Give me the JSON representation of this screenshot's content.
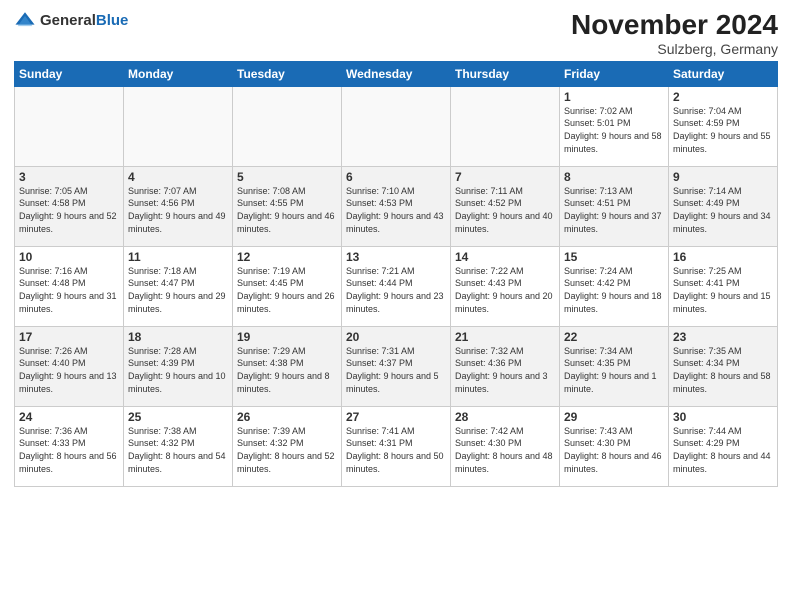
{
  "header": {
    "logo_general": "General",
    "logo_blue": "Blue",
    "month_title": "November 2024",
    "location": "Sulzberg, Germany"
  },
  "weekdays": [
    "Sunday",
    "Monday",
    "Tuesday",
    "Wednesday",
    "Thursday",
    "Friday",
    "Saturday"
  ],
  "weeks": [
    [
      {
        "day": "",
        "info": ""
      },
      {
        "day": "",
        "info": ""
      },
      {
        "day": "",
        "info": ""
      },
      {
        "day": "",
        "info": ""
      },
      {
        "day": "",
        "info": ""
      },
      {
        "day": "1",
        "info": "Sunrise: 7:02 AM\nSunset: 5:01 PM\nDaylight: 9 hours and 58 minutes."
      },
      {
        "day": "2",
        "info": "Sunrise: 7:04 AM\nSunset: 4:59 PM\nDaylight: 9 hours and 55 minutes."
      }
    ],
    [
      {
        "day": "3",
        "info": "Sunrise: 7:05 AM\nSunset: 4:58 PM\nDaylight: 9 hours and 52 minutes."
      },
      {
        "day": "4",
        "info": "Sunrise: 7:07 AM\nSunset: 4:56 PM\nDaylight: 9 hours and 49 minutes."
      },
      {
        "day": "5",
        "info": "Sunrise: 7:08 AM\nSunset: 4:55 PM\nDaylight: 9 hours and 46 minutes."
      },
      {
        "day": "6",
        "info": "Sunrise: 7:10 AM\nSunset: 4:53 PM\nDaylight: 9 hours and 43 minutes."
      },
      {
        "day": "7",
        "info": "Sunrise: 7:11 AM\nSunset: 4:52 PM\nDaylight: 9 hours and 40 minutes."
      },
      {
        "day": "8",
        "info": "Sunrise: 7:13 AM\nSunset: 4:51 PM\nDaylight: 9 hours and 37 minutes."
      },
      {
        "day": "9",
        "info": "Sunrise: 7:14 AM\nSunset: 4:49 PM\nDaylight: 9 hours and 34 minutes."
      }
    ],
    [
      {
        "day": "10",
        "info": "Sunrise: 7:16 AM\nSunset: 4:48 PM\nDaylight: 9 hours and 31 minutes."
      },
      {
        "day": "11",
        "info": "Sunrise: 7:18 AM\nSunset: 4:47 PM\nDaylight: 9 hours and 29 minutes."
      },
      {
        "day": "12",
        "info": "Sunrise: 7:19 AM\nSunset: 4:45 PM\nDaylight: 9 hours and 26 minutes."
      },
      {
        "day": "13",
        "info": "Sunrise: 7:21 AM\nSunset: 4:44 PM\nDaylight: 9 hours and 23 minutes."
      },
      {
        "day": "14",
        "info": "Sunrise: 7:22 AM\nSunset: 4:43 PM\nDaylight: 9 hours and 20 minutes."
      },
      {
        "day": "15",
        "info": "Sunrise: 7:24 AM\nSunset: 4:42 PM\nDaylight: 9 hours and 18 minutes."
      },
      {
        "day": "16",
        "info": "Sunrise: 7:25 AM\nSunset: 4:41 PM\nDaylight: 9 hours and 15 minutes."
      }
    ],
    [
      {
        "day": "17",
        "info": "Sunrise: 7:26 AM\nSunset: 4:40 PM\nDaylight: 9 hours and 13 minutes."
      },
      {
        "day": "18",
        "info": "Sunrise: 7:28 AM\nSunset: 4:39 PM\nDaylight: 9 hours and 10 minutes."
      },
      {
        "day": "19",
        "info": "Sunrise: 7:29 AM\nSunset: 4:38 PM\nDaylight: 9 hours and 8 minutes."
      },
      {
        "day": "20",
        "info": "Sunrise: 7:31 AM\nSunset: 4:37 PM\nDaylight: 9 hours and 5 minutes."
      },
      {
        "day": "21",
        "info": "Sunrise: 7:32 AM\nSunset: 4:36 PM\nDaylight: 9 hours and 3 minutes."
      },
      {
        "day": "22",
        "info": "Sunrise: 7:34 AM\nSunset: 4:35 PM\nDaylight: 9 hours and 1 minute."
      },
      {
        "day": "23",
        "info": "Sunrise: 7:35 AM\nSunset: 4:34 PM\nDaylight: 8 hours and 58 minutes."
      }
    ],
    [
      {
        "day": "24",
        "info": "Sunrise: 7:36 AM\nSunset: 4:33 PM\nDaylight: 8 hours and 56 minutes."
      },
      {
        "day": "25",
        "info": "Sunrise: 7:38 AM\nSunset: 4:32 PM\nDaylight: 8 hours and 54 minutes."
      },
      {
        "day": "26",
        "info": "Sunrise: 7:39 AM\nSunset: 4:32 PM\nDaylight: 8 hours and 52 minutes."
      },
      {
        "day": "27",
        "info": "Sunrise: 7:41 AM\nSunset: 4:31 PM\nDaylight: 8 hours and 50 minutes."
      },
      {
        "day": "28",
        "info": "Sunrise: 7:42 AM\nSunset: 4:30 PM\nDaylight: 8 hours and 48 minutes."
      },
      {
        "day": "29",
        "info": "Sunrise: 7:43 AM\nSunset: 4:30 PM\nDaylight: 8 hours and 46 minutes."
      },
      {
        "day": "30",
        "info": "Sunrise: 7:44 AM\nSunset: 4:29 PM\nDaylight: 8 hours and 44 minutes."
      }
    ]
  ]
}
